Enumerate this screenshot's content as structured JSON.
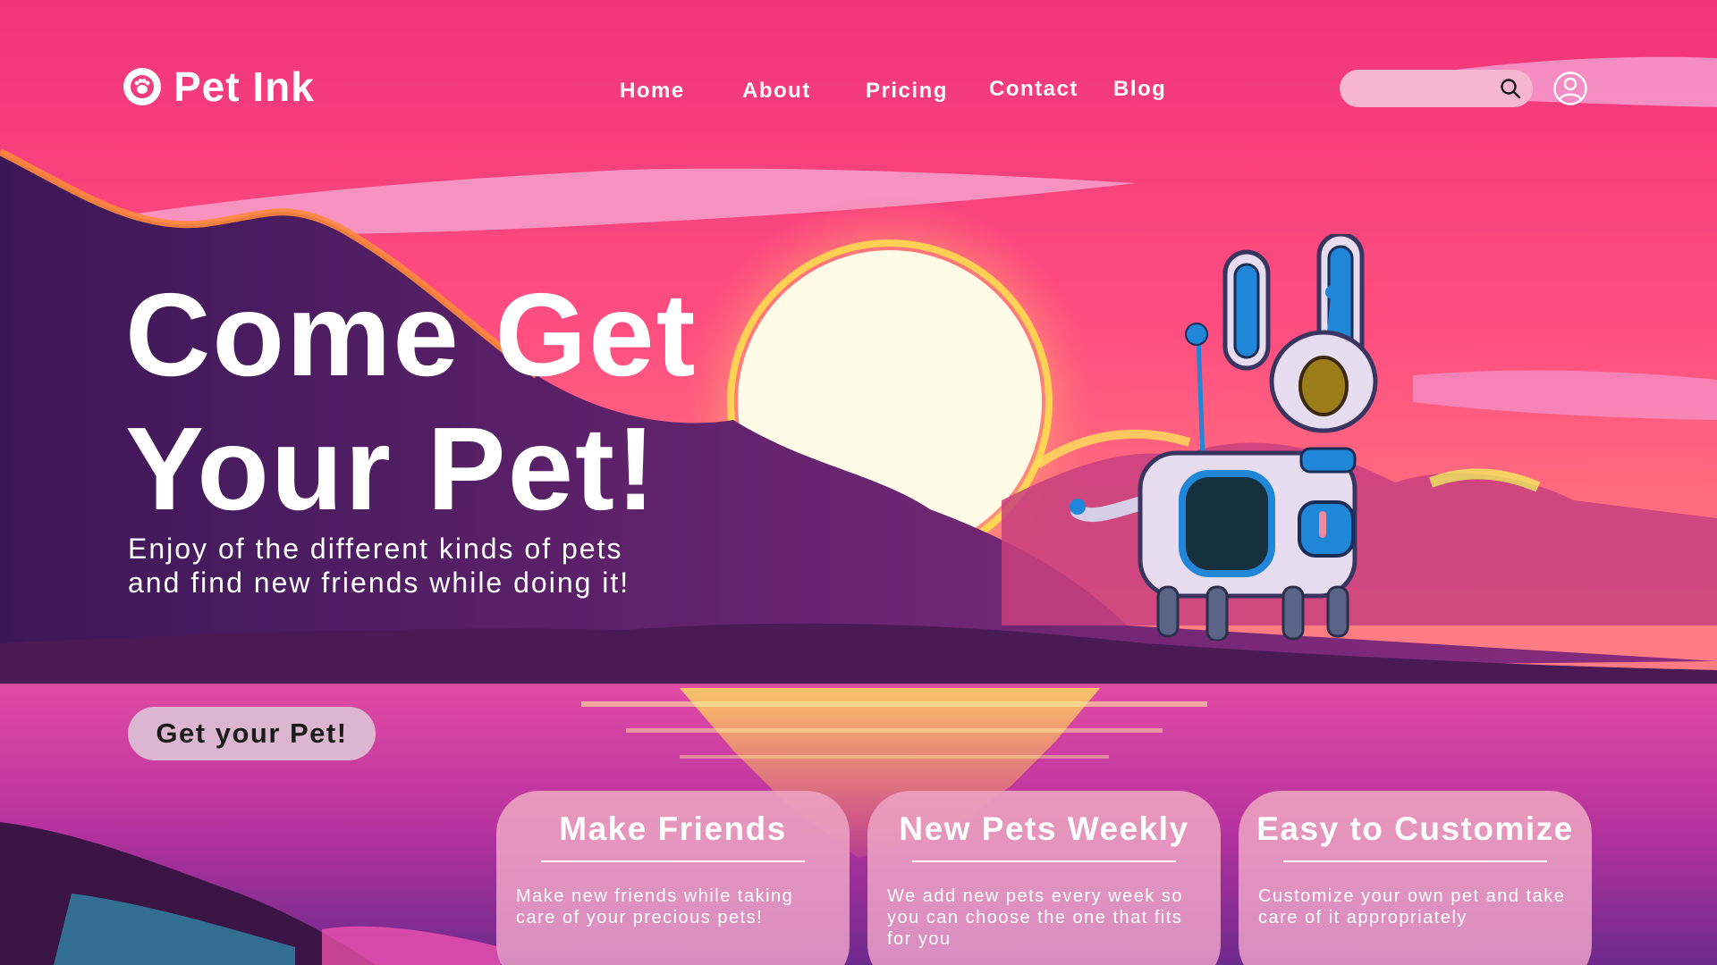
{
  "brand": {
    "name": "Pet Ink",
    "logo_icon": "paw-icon"
  },
  "nav": {
    "items": [
      "Home",
      "About",
      "Pricing",
      "Contact",
      "Blog"
    ]
  },
  "search": {
    "placeholder": "",
    "icon": "search-icon"
  },
  "account": {
    "icon": "user-icon"
  },
  "hero": {
    "title_line1": "Come Get",
    "title_line2": "Your Pet!",
    "subtitle_line1": "Enjoy of the different kinds of pets",
    "subtitle_line2": "and find new friends while doing it!",
    "cta_label": "Get your Pet!"
  },
  "cards": [
    {
      "title": "Make Friends",
      "text": "Make new friends while taking care of your precious pets!"
    },
    {
      "title": "New Pets Weekly",
      "text": "We add new pets every week so you can choose the one that fits for you"
    },
    {
      "title": "Easy to Customize",
      "text": "Customize your own pet and take care of it appropriately"
    }
  ],
  "colors": {
    "sky_top": "#f23b79",
    "sky_mid": "#ff5c8a",
    "sun": "#fffbe6",
    "mountain": "#5b1f6e",
    "water": "#b0319b",
    "card": "#eca0be",
    "cta": "#dcb6d1"
  }
}
